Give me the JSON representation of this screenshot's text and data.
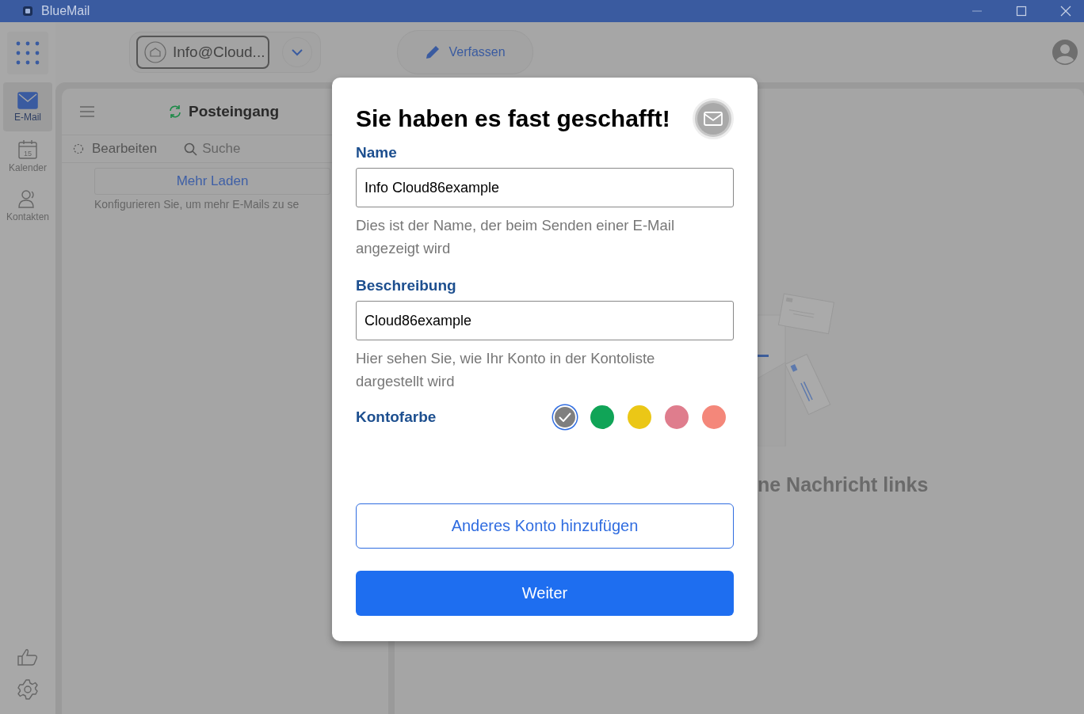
{
  "window": {
    "title": "BlueMail"
  },
  "topbar": {
    "account": "Info@Cloud...",
    "compose": "Verfassen"
  },
  "rail": [
    {
      "kind": "mail",
      "label": "E-Mail",
      "selected": true
    },
    {
      "kind": "calendar",
      "label": "Kalender",
      "day": "15",
      "selected": false
    },
    {
      "kind": "contacts",
      "label": "Kontakten",
      "selected": false
    }
  ],
  "list": {
    "title": "Posteingang",
    "edit": "Bearbeiten",
    "search": {
      "placeholder": "Suche"
    },
    "load_more": "Mehr Laden",
    "hint": "Konfigurieren Sie, um mehr E-Mails zu se"
  },
  "reading_pane": {
    "message": "ne Nachricht links"
  },
  "dialog": {
    "title": "Sie haben es fast geschafft!",
    "fields": [
      {
        "label": "Name",
        "value": "Info Cloud86example",
        "help": "Dies ist der Name, der beim Senden einer E-Mail angezeigt wird"
      },
      {
        "label": "Beschreibung",
        "value": "Cloud86example",
        "help": "Hier sehen Sie, wie Ihr Konto in der Kontoliste dargestellt wird"
      }
    ],
    "color_label": "Kontofarbe",
    "colors": [
      {
        "color": "#7f7f7f",
        "selected": true
      },
      {
        "color": "#10a457",
        "selected": false
      },
      {
        "color": "#ebc716",
        "selected": false
      },
      {
        "color": "#df7d8d",
        "selected": false
      },
      {
        "color": "#f4877a",
        "selected": false
      }
    ],
    "secondary_button": "Anderes Konto hinzufügen",
    "primary_button": "Weiter"
  }
}
